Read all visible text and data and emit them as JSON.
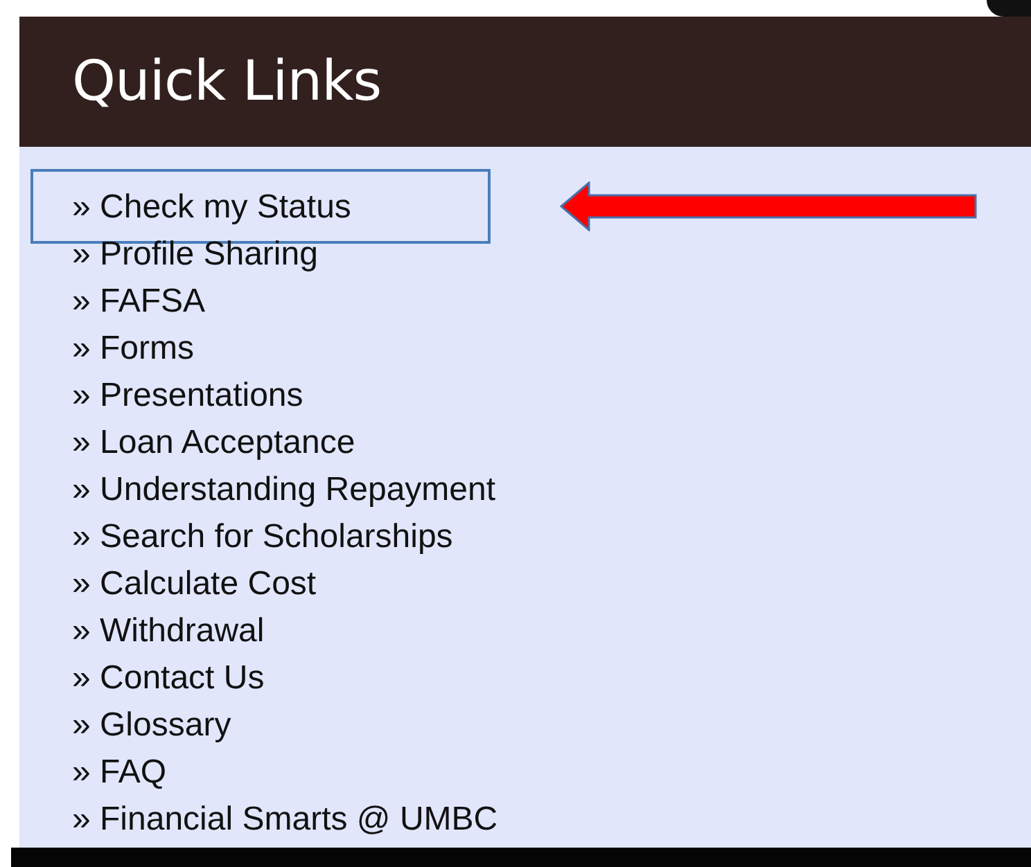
{
  "header": {
    "title": "Quick Links"
  },
  "links": [
    {
      "label": "» Check my Status",
      "highlighted": true
    },
    {
      "label": "» Profile Sharing",
      "highlighted": false
    },
    {
      "label": "» FAFSA",
      "highlighted": false
    },
    {
      "label": "» Forms",
      "highlighted": false
    },
    {
      "label": "» Presentations",
      "highlighted": false
    },
    {
      "label": "» Loan Acceptance",
      "highlighted": false
    },
    {
      "label": "» Understanding Repayment",
      "highlighted": false
    },
    {
      "label": "» Search for Scholarships",
      "highlighted": false
    },
    {
      "label": "» Calculate Cost",
      "highlighted": false
    },
    {
      "label": "» Withdrawal",
      "highlighted": false
    },
    {
      "label": "» Contact Us",
      "highlighted": false
    },
    {
      "label": "» Glossary",
      "highlighted": false
    },
    {
      "label": "» FAQ",
      "highlighted": false
    },
    {
      "label": "» Financial Smarts @ UMBC",
      "highlighted": false
    }
  ]
}
